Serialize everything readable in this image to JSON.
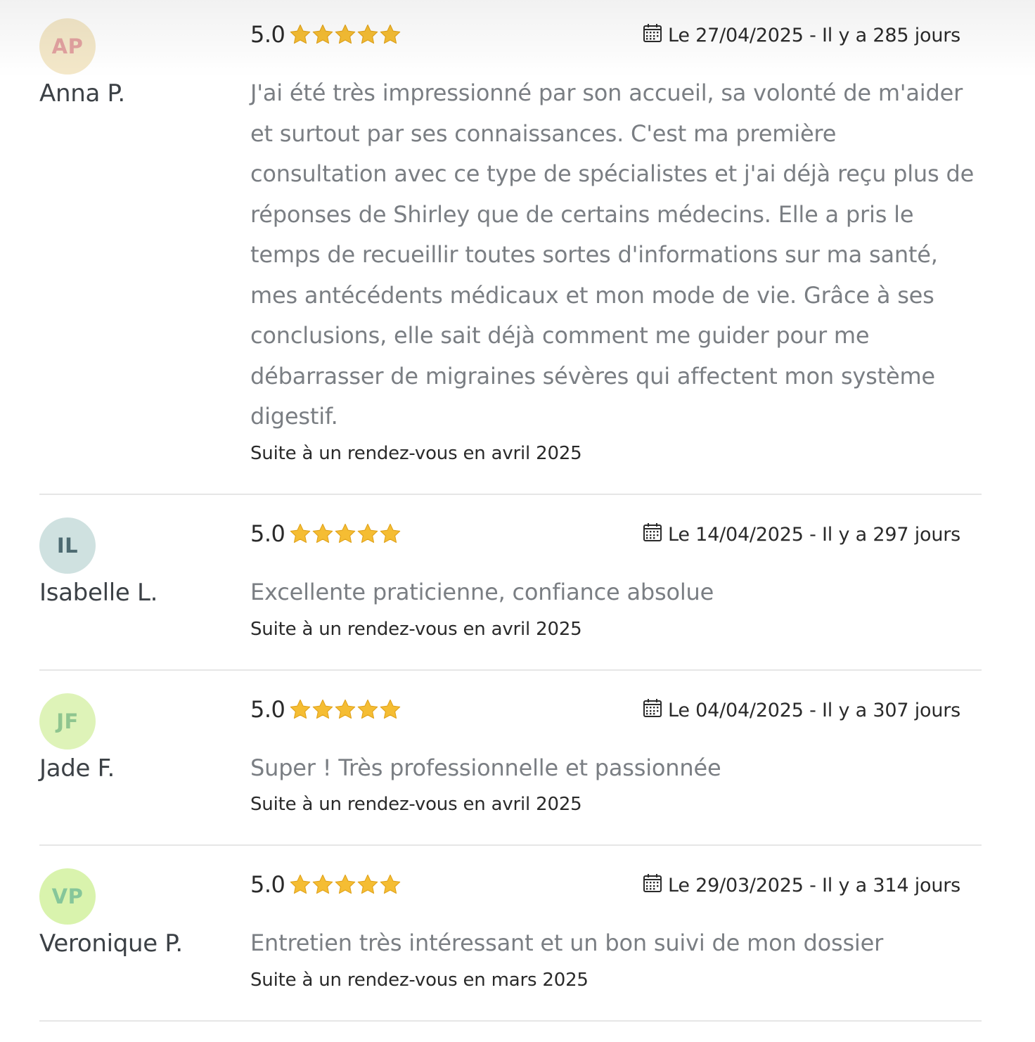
{
  "reviews": [
    {
      "initials": "AP",
      "avatar_bg": "#f4e8c9",
      "avatar_fg": "#e2a2a0",
      "name": "Anna P.",
      "score": "5.0",
      "rating": 5,
      "date": "Le 27/04/2025 - Il y a 285 jours",
      "comment": "J'ai été très impressionné par son accueil, sa volonté de m'aider et surtout par ses connaissances. C'est ma première consultation avec ce type de spécialistes et j'ai déjà reçu plus de réponses de Shirley que de certains médecins. Elle a pris le temps de recueillir toutes sortes d'informations sur ma santé, mes antécédents médicaux et mon mode de vie. Grâce à ses conclusions, elle sait déjà comment me guider pour me débarrasser de migraines sévères qui affectent mon système digestif.",
      "appointment": "Suite à un rendez-vous en avril 2025"
    },
    {
      "initials": "IL",
      "avatar_bg": "#cfe1e0",
      "avatar_fg": "#4e6b72",
      "name": "Isabelle L.",
      "score": "5.0",
      "rating": 5,
      "date": "Le 14/04/2025 - Il y a 297 jours",
      "comment": "Excellente praticienne, confiance absolue",
      "appointment": "Suite à un rendez-vous en avril 2025"
    },
    {
      "initials": "JF",
      "avatar_bg": "#def3b8",
      "avatar_fg": "#8fc58f",
      "name": "Jade F.",
      "score": "5.0",
      "rating": 5,
      "date": "Le 04/04/2025 - Il y a 307 jours",
      "comment": "Super ! Très professionnelle et passionnée",
      "appointment": "Suite à un rendez-vous en avril 2025"
    },
    {
      "initials": "VP",
      "avatar_bg": "#d9f3ad",
      "avatar_fg": "#86c69a",
      "name": "Veronique P.",
      "score": "5.0",
      "rating": 5,
      "date": "Le 29/03/2025 - Il y a 314 jours",
      "comment": "Entretien très intéressant et un bon suivi de mon dossier",
      "appointment": "Suite à un rendez-vous en mars 2025"
    }
  ],
  "colors": {
    "star": "#f5bd33",
    "star_stroke": "#e0a21a",
    "divider": "#e6e6e6"
  },
  "icons": {
    "star": "star-icon",
    "calendar": "calendar-icon"
  }
}
